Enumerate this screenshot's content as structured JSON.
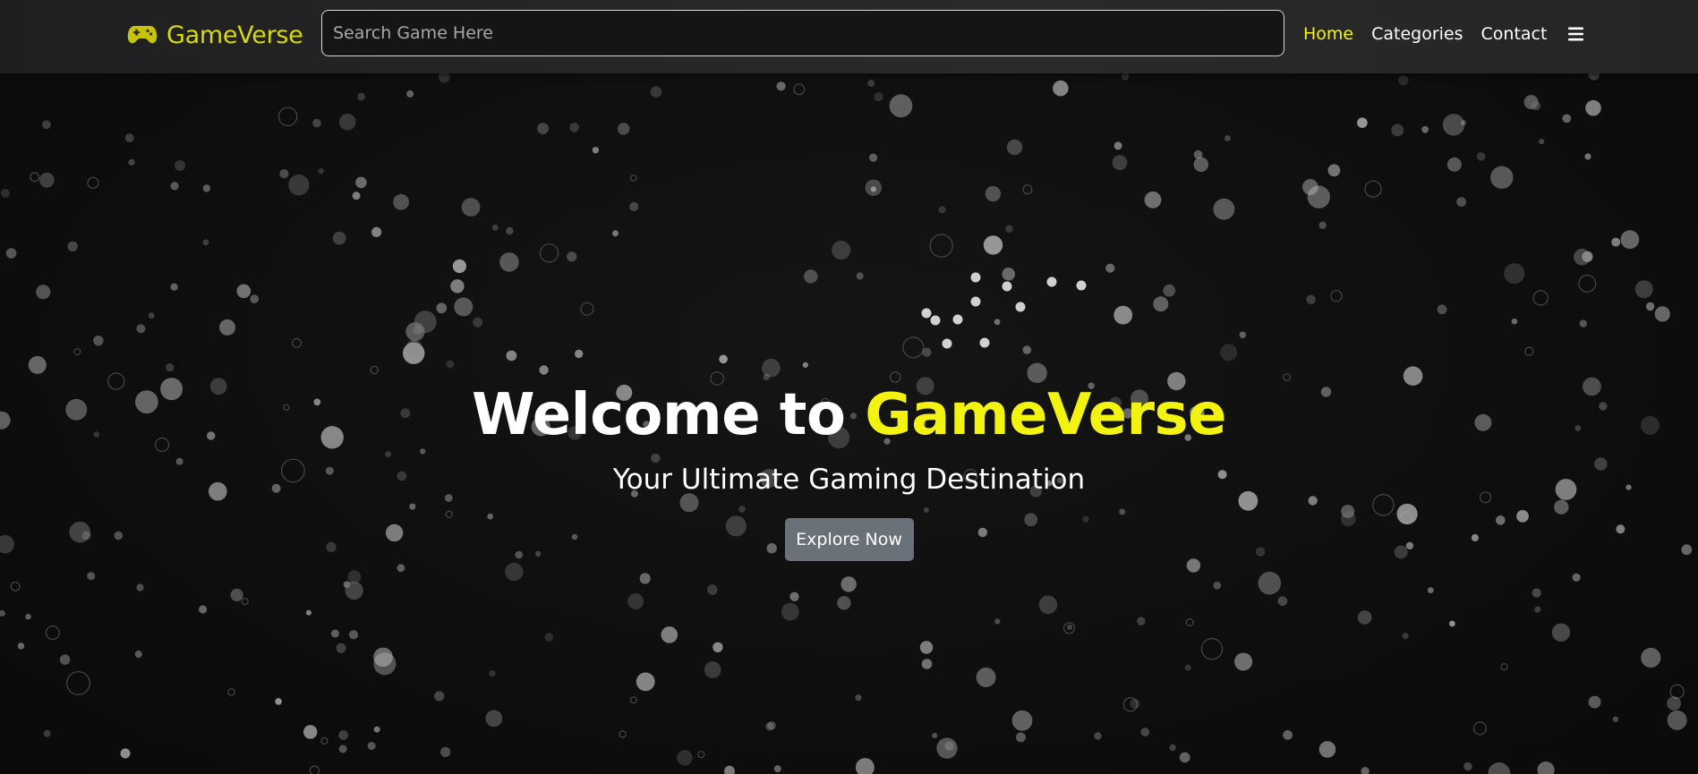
{
  "brand": {
    "name": "GameVerse",
    "icon": "gamepad-icon",
    "color": "#d7d80f"
  },
  "search": {
    "placeholder": "Search Game Here",
    "value": ""
  },
  "nav": {
    "items": [
      {
        "label": "Home",
        "active": true
      },
      {
        "label": "Categories",
        "active": false
      },
      {
        "label": "Contact",
        "active": false
      }
    ],
    "menu_icon": "hamburger-menu-icon",
    "active_color": "#f5f10e"
  },
  "hero": {
    "title_prefix": "Welcome to ",
    "title_accent": "GameVerse",
    "subtitle": "Your Ultimate Gaming Destination",
    "cta_label": "Explore Now",
    "accent_color": "#f3f312",
    "button_color": "#6a7178"
  },
  "background": {
    "decoration": "floating-bubbles",
    "base_color": "#0f0f10"
  }
}
